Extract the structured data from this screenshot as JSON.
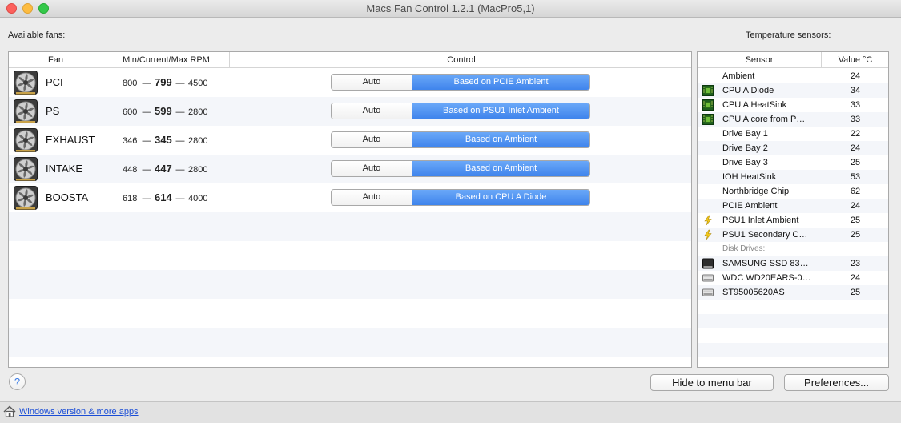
{
  "window": {
    "title": "Macs Fan Control 1.2.1 (MacPro5,1)"
  },
  "labels": {
    "available_fans": "Available fans:",
    "temperature_sensors": "Temperature sensors:"
  },
  "fans_table": {
    "headers": {
      "fan": "Fan",
      "rpm": "Min/Current/Max RPM",
      "control": "Control"
    },
    "rows": [
      {
        "name": "PCI",
        "min": "800",
        "current": "799",
        "max": "4500",
        "auto": "Auto",
        "control": "Based on PCIE Ambient"
      },
      {
        "name": "PS",
        "min": "600",
        "current": "599",
        "max": "2800",
        "auto": "Auto",
        "control": "Based on PSU1 Inlet Ambient"
      },
      {
        "name": "EXHAUST",
        "min": "346",
        "current": "345",
        "max": "2800",
        "auto": "Auto",
        "control": "Based on Ambient"
      },
      {
        "name": "INTAKE",
        "min": "448",
        "current": "447",
        "max": "2800",
        "auto": "Auto",
        "control": "Based on Ambient"
      },
      {
        "name": "BOOSTA",
        "min": "618",
        "current": "614",
        "max": "4000",
        "auto": "Auto",
        "control": "Based on CPU A Diode"
      }
    ],
    "separator": "—"
  },
  "sensors_table": {
    "headers": {
      "sensor": "Sensor",
      "value": "Value °C"
    },
    "rows": [
      {
        "name": "Ambient",
        "value": "24",
        "icon": "none"
      },
      {
        "name": "CPU A Diode",
        "value": "34",
        "icon": "chip-icon"
      },
      {
        "name": "CPU A HeatSink",
        "value": "33",
        "icon": "chip-icon"
      },
      {
        "name": "CPU A core from P…",
        "value": "33",
        "icon": "chip-icon"
      },
      {
        "name": "Drive Bay 1",
        "value": "22",
        "icon": "none"
      },
      {
        "name": "Drive Bay 2",
        "value": "24",
        "icon": "none"
      },
      {
        "name": "Drive Bay 3",
        "value": "25",
        "icon": "none"
      },
      {
        "name": "IOH HeatSink",
        "value": "53",
        "icon": "none"
      },
      {
        "name": "Northbridge Chip",
        "value": "62",
        "icon": "none"
      },
      {
        "name": "PCIE Ambient",
        "value": "24",
        "icon": "none"
      },
      {
        "name": "PSU1 Inlet Ambient",
        "value": "25",
        "icon": "lightning-icon"
      },
      {
        "name": "PSU1 Secondary C…",
        "value": "25",
        "icon": "lightning-icon"
      }
    ],
    "disk_section_label": "Disk Drives:",
    "disks": [
      {
        "name": "SAMSUNG SSD 83…",
        "value": "23",
        "icon": "ssd-icon"
      },
      {
        "name": "WDC WD20EARS-0…",
        "value": "24",
        "icon": "hdd-icon"
      },
      {
        "name": "ST95005620AS",
        "value": "25",
        "icon": "hdd-icon"
      }
    ]
  },
  "footer": {
    "help": "?",
    "hide_button": "Hide to menu bar",
    "preferences_button": "Preferences...",
    "link": "Windows version & more apps"
  },
  "colors": {
    "accent": "#3f84ec",
    "link": "#1a4dd6"
  }
}
